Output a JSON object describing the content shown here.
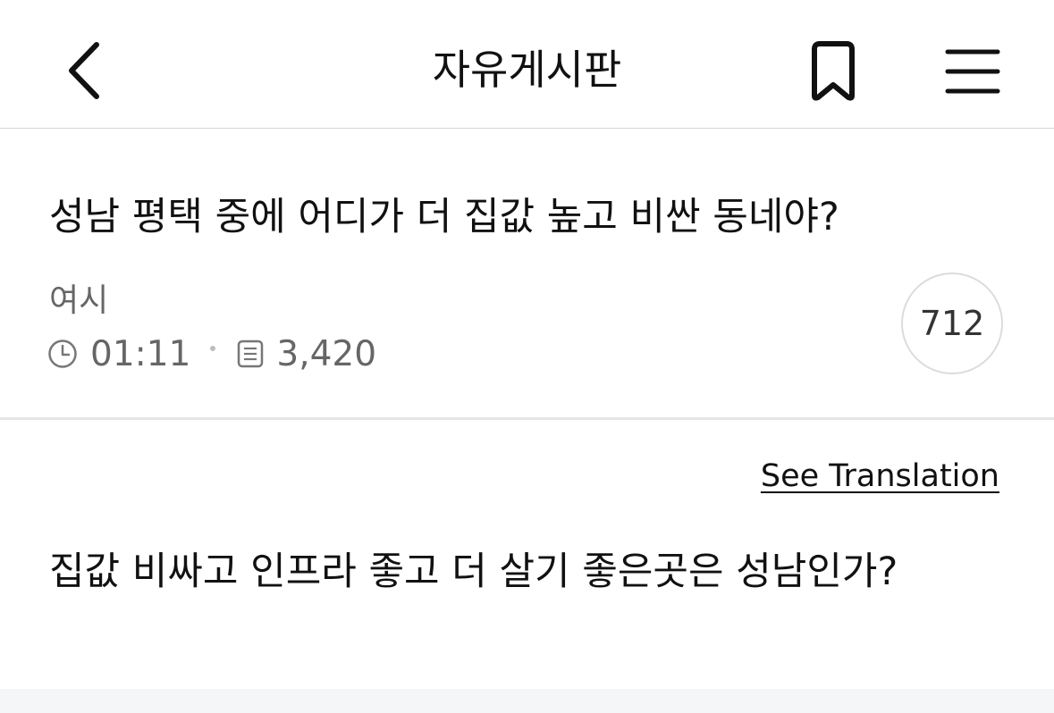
{
  "header": {
    "title": "자유게시판",
    "back_icon": "chevron-left-icon",
    "bookmark_icon": "bookmark-icon",
    "menu_icon": "hamburger-menu-icon"
  },
  "post": {
    "title": "성남 평택 중에 어디가 더 집값 높고 비싼 동네야?",
    "author": "여시",
    "time": "01:11",
    "views": "3,420",
    "comment_count": "712",
    "translate_label": "See Translation",
    "body": "집값 비싸고 인프라 좋고 더 살기 좋은곳은 성남인가?"
  },
  "colors": {
    "text": "#111111",
    "muted": "#666666",
    "divider": "#e6e6e6"
  }
}
